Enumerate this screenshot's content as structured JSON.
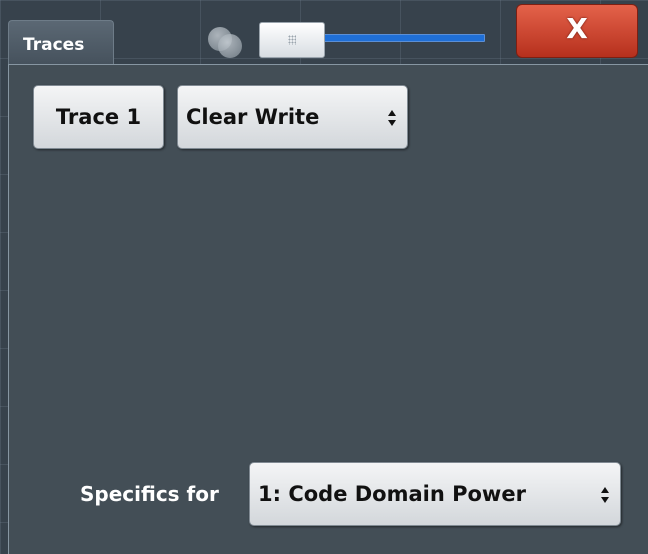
{
  "dialog": {
    "title": "Traces",
    "close_label": "X"
  },
  "slider": {
    "value_fraction": 0.0
  },
  "trace": {
    "selector_label": "Trace 1",
    "mode_value": "Clear Write"
  },
  "specifics": {
    "label": "Specifics for",
    "value": "1: Code Domain Power"
  },
  "icons": {
    "close": "close-icon",
    "spinner": "up-down-arrows-icon",
    "slider_grip": "grip-icon"
  },
  "colors": {
    "close_button": "#c9432c",
    "slider_track": "#1f6fd6",
    "panel_background": "#434e56"
  }
}
